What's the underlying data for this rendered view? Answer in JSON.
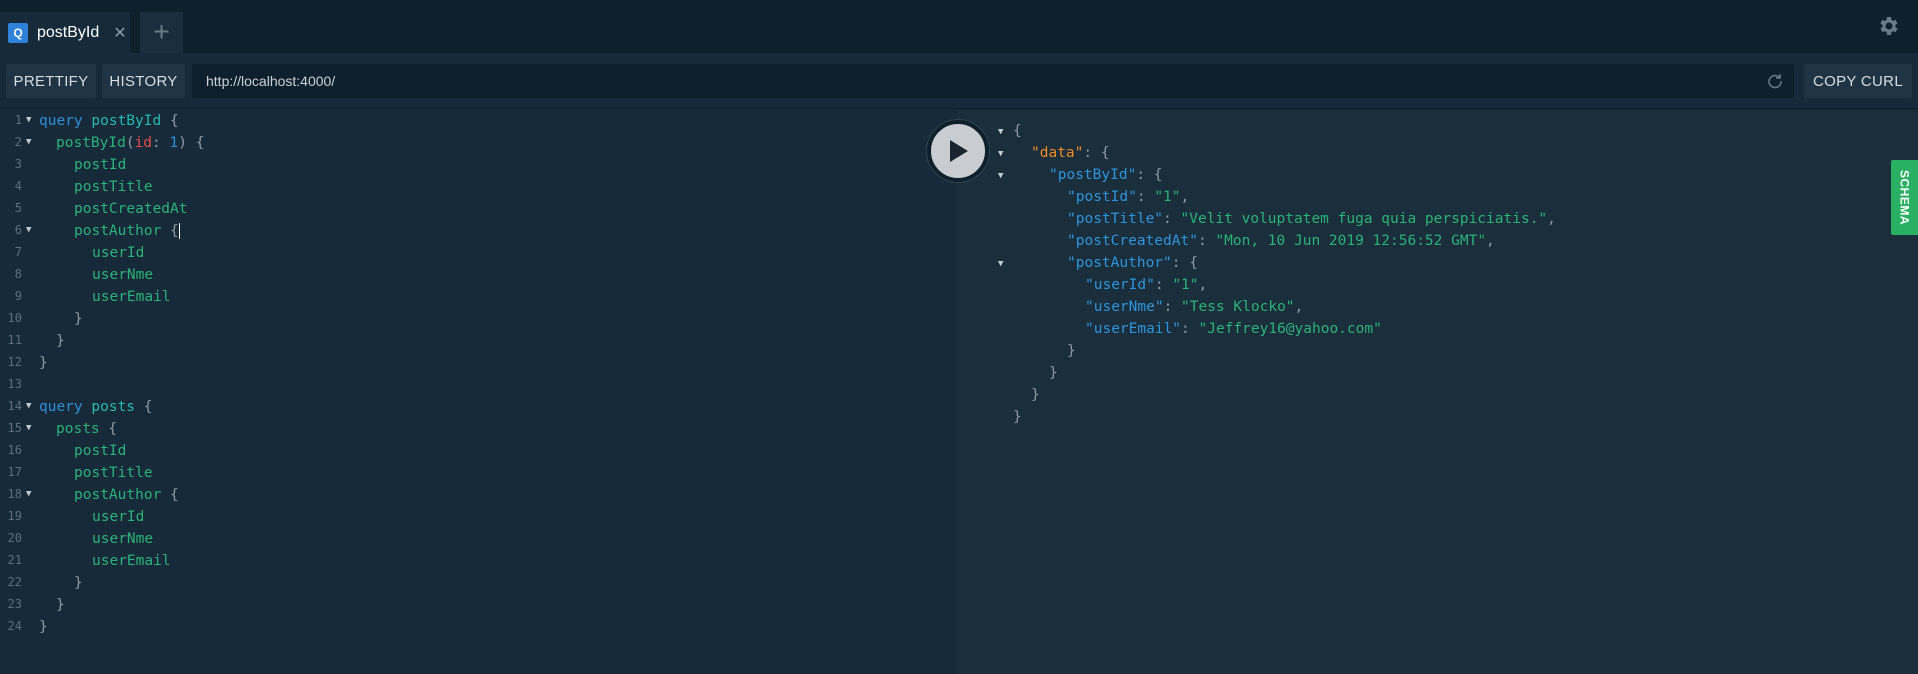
{
  "tabs": [
    {
      "icon_letter": "Q",
      "title": "postById",
      "close_icon": "✕"
    }
  ],
  "add_tab_icon": "+",
  "toolbar": {
    "prettify_label": "PRETTIFY",
    "history_label": "HISTORY",
    "url": "http://localhost:4000/",
    "copy_curl_label": "COPY CURL"
  },
  "schema_label": "SCHEMA",
  "query": {
    "line_numbers": [
      "1",
      "2",
      "3",
      "4",
      "5",
      "6",
      "7",
      "8",
      "9",
      "10",
      "11",
      "12",
      "13",
      "14",
      "15",
      "16",
      "17",
      "18",
      "19",
      "20",
      "21",
      "22",
      "23",
      "24"
    ],
    "q1_keyword": "query",
    "q1_name": "postById",
    "q1_field": "postById",
    "q1_arg": "id",
    "q1_arg_value": "1",
    "q1_fields": [
      "postId",
      "postTitle",
      "postCreatedAt",
      "postAuthor"
    ],
    "q1_author_fields": [
      "userId",
      "userNme",
      "userEmail"
    ],
    "q2_keyword": "query",
    "q2_name": "posts",
    "q2_field": "posts",
    "q2_fields": [
      "postId",
      "postTitle",
      "postAuthor"
    ],
    "q2_author_fields": [
      "userId",
      "userNme",
      "userEmail"
    ]
  },
  "response": {
    "data_key": "\"data\"",
    "post_by_id_key": "\"postById\"",
    "post_id_key": "\"postId\"",
    "post_id_value": "\"1\"",
    "post_title_key": "\"postTitle\"",
    "post_title_value": "\"Velit voluptatem fuga quia perspiciatis.\"",
    "post_created_key": "\"postCreatedAt\"",
    "post_created_value": "\"Mon, 10 Jun 2019 12:56:52 GMT\"",
    "post_author_key": "\"postAuthor\"",
    "user_id_key": "\"userId\"",
    "user_id_value": "\"1\"",
    "user_name_key": "\"userNme\"",
    "user_name_value": "\"Tess Klocko\"",
    "user_email_key": "\"userEmail\"",
    "user_email_value": "\"Jeffrey16@yahoo.com\""
  },
  "colors": {
    "background": "#172a3a",
    "keyword": "#2d8ed9",
    "field": "#2ab377",
    "arg": "#e24e4c",
    "data_key": "#ef8c23",
    "schema_tab": "#2ab063"
  }
}
